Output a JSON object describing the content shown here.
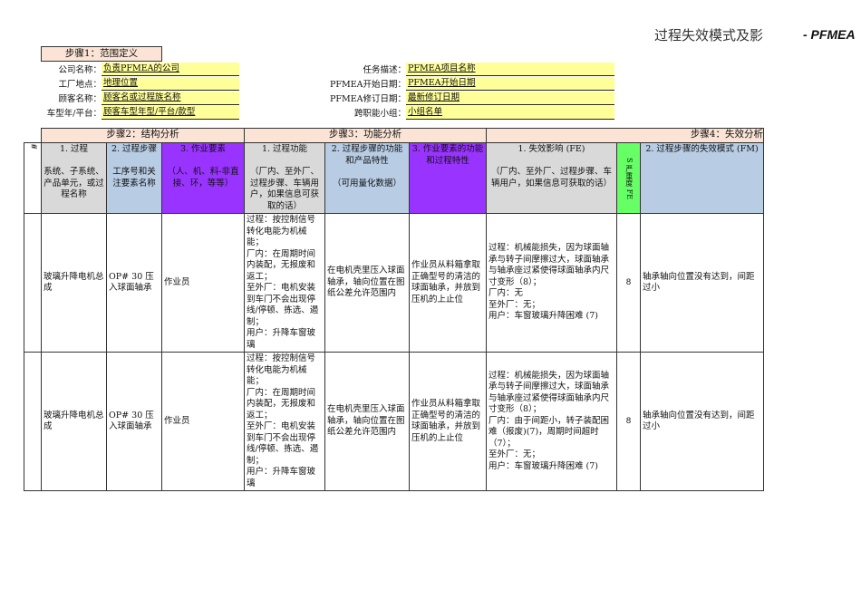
{
  "header": {
    "title": "过程失效模式及影",
    "brand": "- PFMEA"
  },
  "step1": {
    "title": "步骤1：范围定义",
    "left": [
      {
        "label": "公司名称：",
        "value": "负责PFMEA的公司"
      },
      {
        "label": "工厂地点：",
        "value": "地理位置"
      },
      {
        "label": "顾客名称：",
        "value": "顾客名或过程族名称"
      },
      {
        "label": "车型年/平台：",
        "value": "顾客车型年型/平台/款型"
      }
    ],
    "right": [
      {
        "label": "任务描述：",
        "value": "PFMEA项目名称"
      },
      {
        "label": "PFMEA开始日期：",
        "value": "PFMEA开始日期"
      },
      {
        "label": "PFMEA修订日期：",
        "value": "最新修订日期"
      },
      {
        "label": "跨职能小组：",
        "value": "小组名单"
      }
    ]
  },
  "steps": {
    "s2": "步骤2：结构分析",
    "s3": "步骤3：功能分析",
    "s4": "步骤4：失效分析"
  },
  "columns": {
    "rownum": "#",
    "c1": "1. 过程",
    "c1d": "系统、子系统、产品单元，或过程名称",
    "c2": "2. 过程步骤",
    "c2d": "工序号和关注要素名称",
    "c3": "3. 作业要素",
    "c3d": "（人、机、料-非直接、环，等等）",
    "c4": "1. 过程功能",
    "c4d": "（厂内、至外厂、过程步骤、车辆用户，如果信息可获取的话）",
    "c5": "2. 过程步骤的功能和产品特性",
    "c5d": "（可用量化数据）",
    "c6": "3. 作业要素的功能和过程特性",
    "c7": "1. 失效影响 (FE)",
    "c7d": "（厂内、至外厂、过程步骤、车辆用户，如果信息可获取的话）",
    "s": "S 严重度 FE",
    "c8": "2. 过程步骤的失效模式 (FM)"
  },
  "rows": [
    {
      "c1": "玻璃升降电机总成",
      "c2": "OP# 30 压入球面轴承",
      "c3": "作业员",
      "c4": "过程：按控制信号转化电能为机械能；\n厂内：在周期时间内装配，无报废和返工；\n至外厂：电机安装到车门不会出现停线/停顿、拣选、遏制；\n用户：升降车窗玻璃",
      "c5": "在电机壳里压入球面轴承，轴向位置在图纸公差允许范围内",
      "c6": "作业员从料箱拿取正确型号的清洁的球面轴承，并放到压机的上止位",
      "c7": "过程：机械能损失，因为球面轴承与转子间摩擦过大，球面轴承与轴承座过紧使得球面轴承内尺寸变形（8）；\n厂内：无\n至外厂：无；\n用户：车窗玻璃升降困难 (7)",
      "s": "8",
      "c8": "轴承轴向位置没有达到，间距过小"
    },
    {
      "c1": "玻璃升降电机总成",
      "c2": "OP# 30 压入球面轴承",
      "c3": "作业员",
      "c4": "过程：按控制信号转化电能为机械能；\n厂内：在周期时间内装配，无报废和返工；\n至外厂：电机安装到车门不会出现停线/停顿、拣选、遏制；\n用户：升降车窗玻璃",
      "c5": "在电机壳里压入球面轴承，轴向位置在图纸公差允许范围内",
      "c6": "作业员从料箱拿取正确型号的清洁的球面轴承，并放到压机的上止位",
      "c7": "过程：机械能损失，因为球面轴承与转子间摩擦过大，球面轴承与轴承座过紧使得球面轴承内尺寸变形（8）；\n厂内：由于间距小，转子装配困难（报废)(7)，周期时间超时（7）；\n至外厂：无；\n用户：车窗玻璃升降困难 (7)",
      "s": "8",
      "c8": "轴承轴向位置没有达到，间距过小"
    }
  ]
}
